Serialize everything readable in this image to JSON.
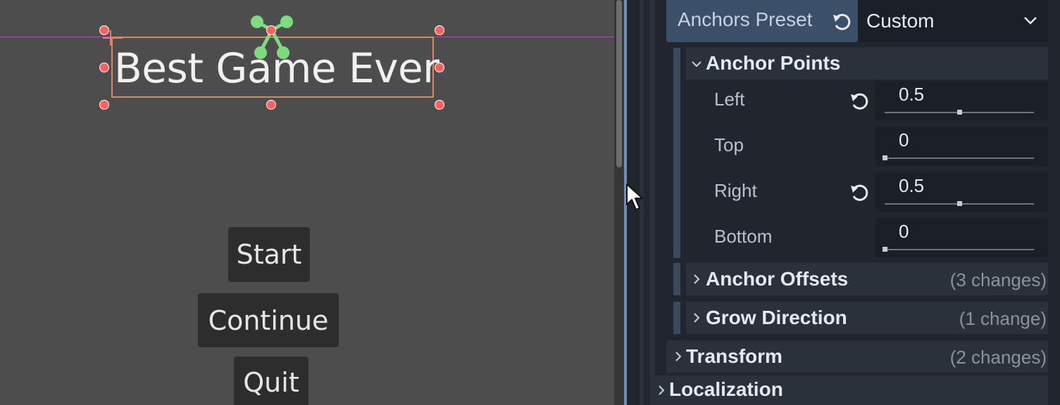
{
  "viewport": {
    "title_label": "Best Game Ever",
    "buttons": {
      "start": "Start",
      "continue": "Continue",
      "quit": "Quit"
    }
  },
  "inspector": {
    "anchors_preset": {
      "label": "Anchors Preset",
      "value": "Custom"
    },
    "anchor_points": {
      "title": "Anchor Points",
      "props": [
        {
          "label": "Left",
          "value": "0.5",
          "ratio": 0.5,
          "modified": true
        },
        {
          "label": "Top",
          "value": "0",
          "ratio": 0,
          "modified": false
        },
        {
          "label": "Right",
          "value": "0.5",
          "ratio": 0.5,
          "modified": true
        },
        {
          "label": "Bottom",
          "value": "0",
          "ratio": 0,
          "modified": false
        }
      ]
    },
    "anchor_offsets": {
      "title": "Anchor Offsets",
      "changes": "(3 changes)"
    },
    "grow_direction": {
      "title": "Grow Direction",
      "changes": "(1 change)"
    },
    "transform": {
      "title": "Transform",
      "changes": "(2 changes)"
    },
    "localization": {
      "title": "Localization"
    }
  },
  "colors": {
    "viewport_bg": "#4d4d4d",
    "inspector_bg": "#21262e",
    "handle": "#ff6161",
    "selection": "#d9895f",
    "anchor_gizmo": "#7ddc7d",
    "accent": "#3b5068"
  }
}
